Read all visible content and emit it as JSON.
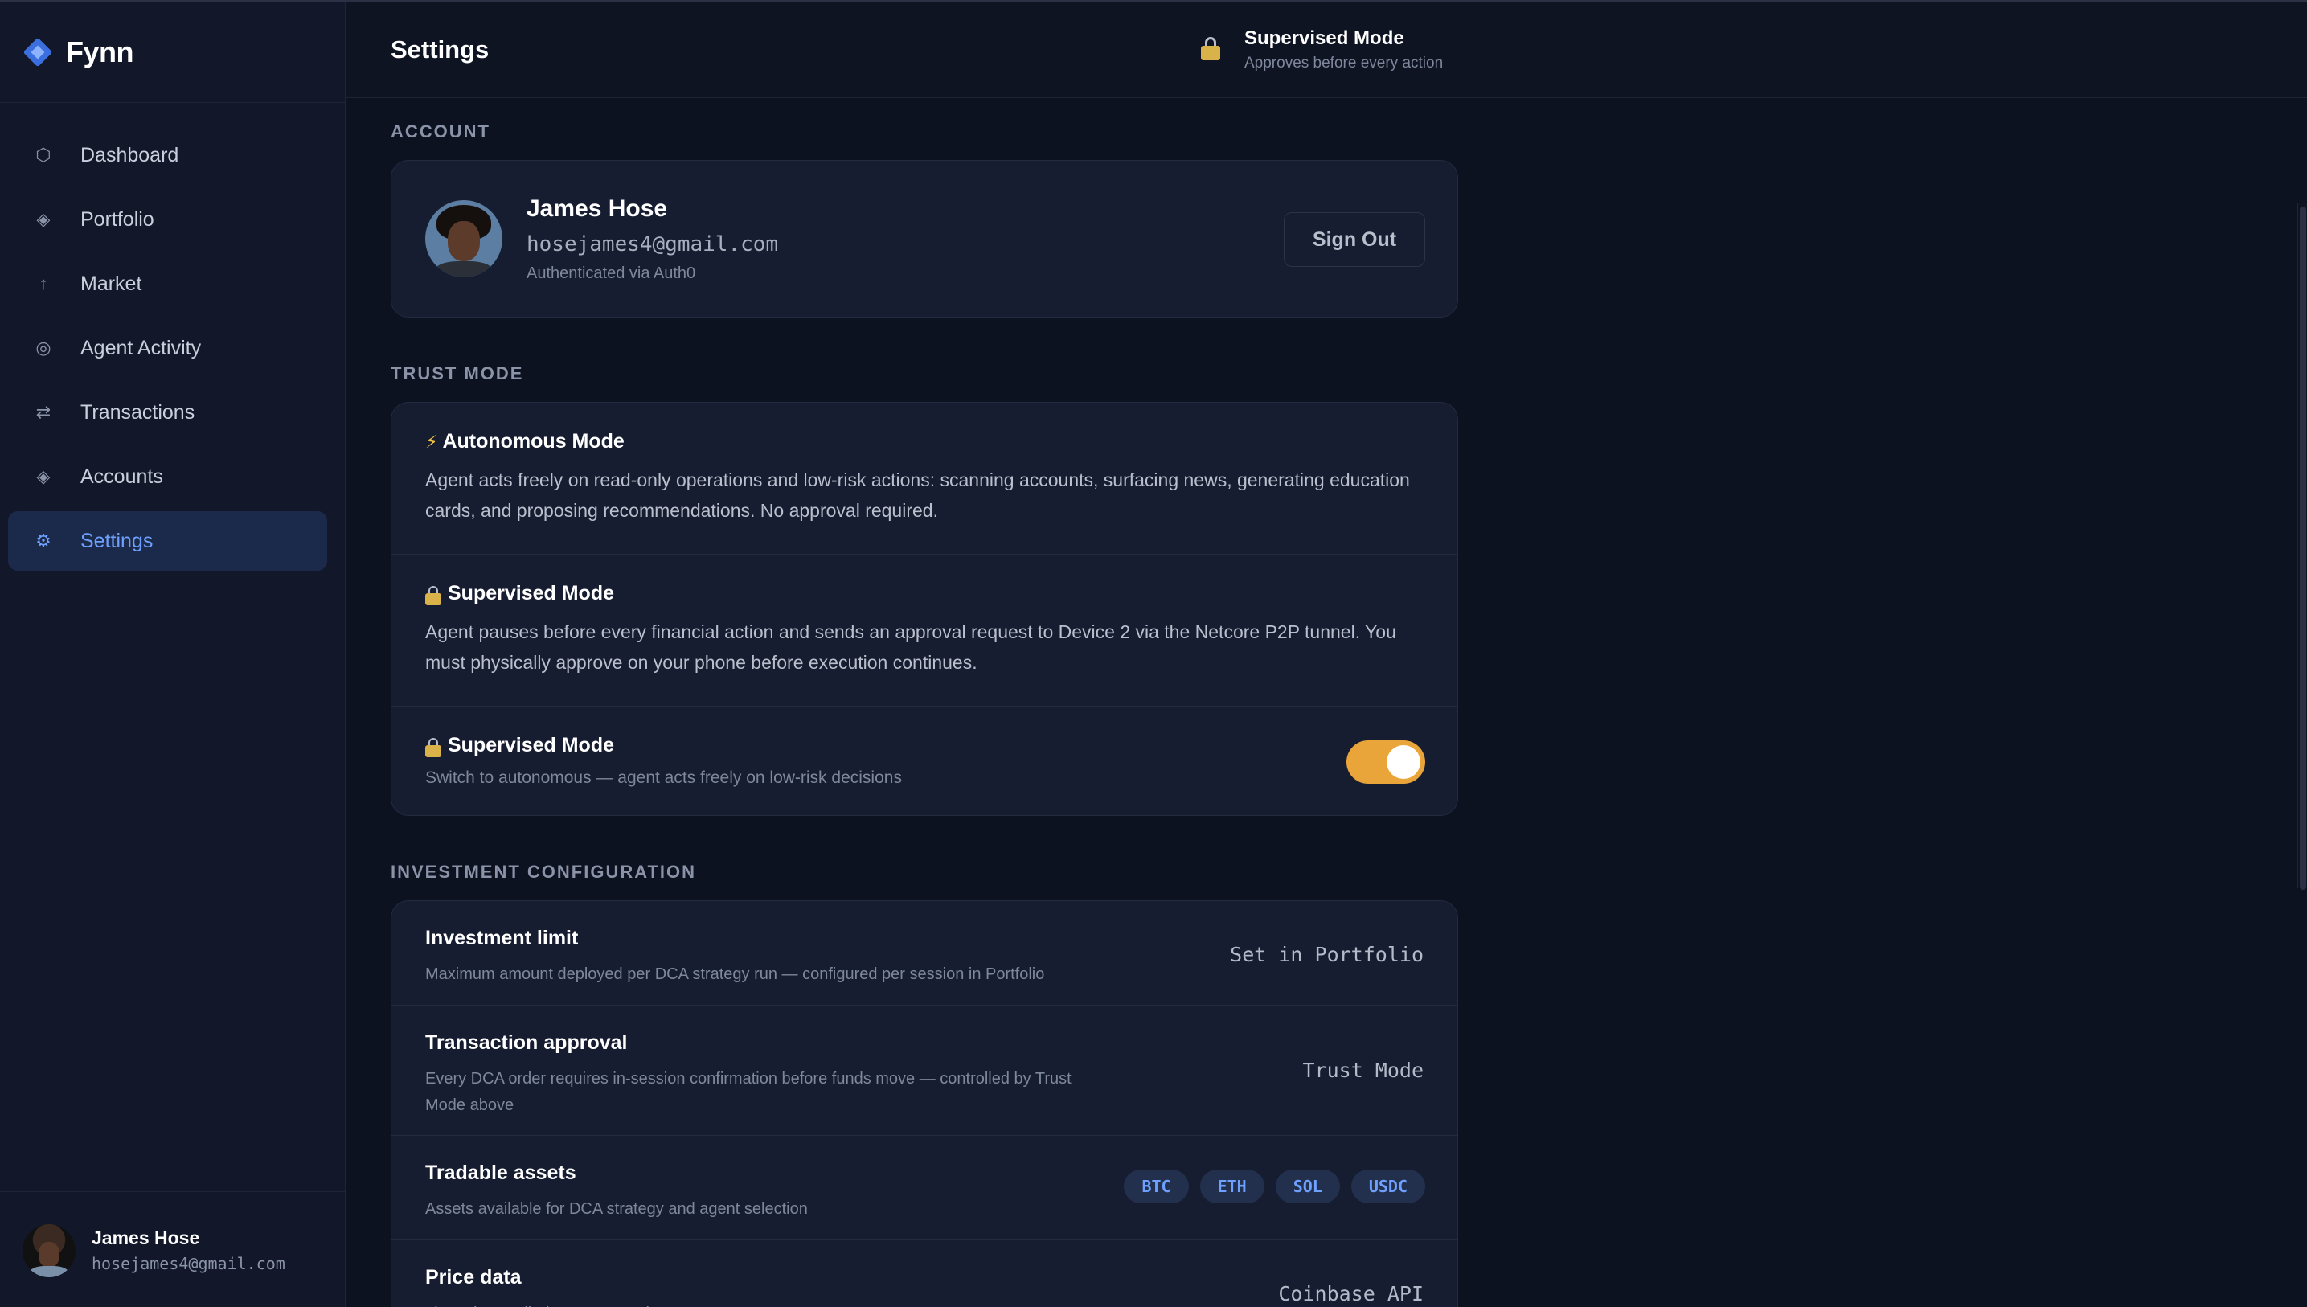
{
  "brand": {
    "name": "Fynn"
  },
  "sidebar": {
    "items": [
      {
        "label": "Dashboard",
        "icon": "hexagon-icon",
        "glyph": "⬡",
        "active": false
      },
      {
        "label": "Portfolio",
        "icon": "diamond-icon",
        "glyph": "◈",
        "active": false
      },
      {
        "label": "Market",
        "icon": "arrow-up-icon",
        "glyph": "↑",
        "active": false
      },
      {
        "label": "Agent Activity",
        "icon": "circle-icon",
        "glyph": "◎",
        "active": false
      },
      {
        "label": "Transactions",
        "icon": "swap-icon",
        "glyph": "⇄",
        "active": false
      },
      {
        "label": "Accounts",
        "icon": "half-diamond-icon",
        "glyph": "◈",
        "active": false
      },
      {
        "label": "Settings",
        "icon": "gear-icon",
        "glyph": "⚙",
        "active": true
      }
    ],
    "user": {
      "name": "James Hose",
      "email": "hosejames4@gmail.com"
    }
  },
  "header": {
    "title": "Settings",
    "mode": {
      "title": "Supervised Mode",
      "subtitle": "Approves before every action"
    }
  },
  "account": {
    "section_label": "ACCOUNT",
    "name": "James Hose",
    "email": "hosejames4@gmail.com",
    "auth": "Authenticated via Auth0",
    "sign_out_label": "Sign Out"
  },
  "trust": {
    "section_label": "TRUST MODE",
    "autonomous": {
      "title": "Autonomous Mode",
      "description": "Agent acts freely on read-only operations and low-risk actions: scanning accounts, surfacing news, generating education cards, and proposing recommendations. No approval required."
    },
    "supervised": {
      "title": "Supervised Mode",
      "description": "Agent pauses before every financial action and sends an approval request to Device 2 via the Netcore P2P tunnel. You must physically approve on your phone before execution continues."
    },
    "toggle": {
      "title": "Supervised Mode",
      "subtitle": "Switch to autonomous — agent acts freely on low-risk decisions",
      "on": true
    }
  },
  "investment": {
    "section_label": "INVESTMENT CONFIGURATION",
    "rows": [
      {
        "title": "Investment limit",
        "description": "Maximum amount deployed per DCA strategy run — configured per session in Portfolio",
        "value": "Set in Portfolio"
      },
      {
        "title": "Transaction approval",
        "description": "Every DCA order requires in-session confirmation before funds move — controlled by Trust Mode above",
        "value": "Trust Mode"
      },
      {
        "title": "Tradable assets",
        "description": "Assets available for DCA strategy and agent selection",
        "assets": [
          "BTC",
          "ETH",
          "SOL",
          "USDC"
        ]
      },
      {
        "title": "Price data",
        "description": "Live prices polled every second",
        "value": "Coinbase API"
      }
    ]
  },
  "colors": {
    "accent": "#6ea0ff",
    "toggle_on": "#e9a53a",
    "background": "#0d1220",
    "card": "#161d30"
  }
}
